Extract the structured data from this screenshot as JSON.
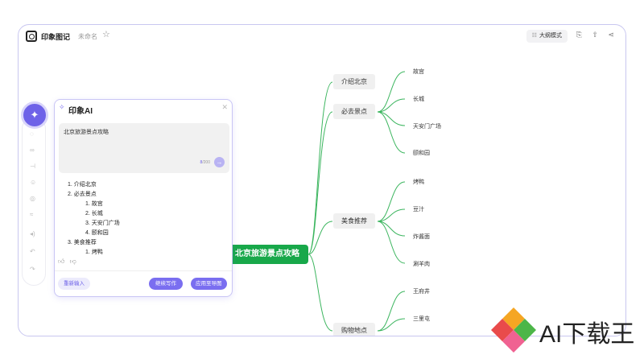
{
  "topbar": {
    "app_name": "印象图记",
    "doc_name": "未命名",
    "outline_mode": "大纲模式"
  },
  "mindmap": {
    "root": "北京旅游景点攻略",
    "branches": [
      {
        "label": "介绍北京",
        "leaves": []
      },
      {
        "label": "必去景点",
        "leaves": [
          "故宫",
          "长城",
          "天安门广场",
          "颐和园"
        ]
      },
      {
        "label": "美食推荐",
        "leaves": [
          "烤鸭",
          "豆汁",
          "炸酱面",
          "涮羊肉"
        ]
      },
      {
        "label": "购物地点",
        "leaves": [
          "王府井",
          "三里屯"
        ]
      }
    ]
  },
  "ai_panel": {
    "title": "印象AI",
    "input_text": "北京旅游景点攻略",
    "counter_current": "8",
    "counter_max": "/200",
    "result": [
      {
        "text": "1. 介绍北京",
        "level": 0
      },
      {
        "text": "2. 必去景点",
        "level": 0
      },
      {
        "text": "1. 故宫",
        "level": 1
      },
      {
        "text": "2. 长城",
        "level": 1
      },
      {
        "text": "3. 天安门广场",
        "level": 1
      },
      {
        "text": "4. 颐和园",
        "level": 1
      },
      {
        "text": "3. 美食推荐",
        "level": 0
      },
      {
        "text": "1. 烤鸭",
        "level": 1
      }
    ],
    "reset_label": "重新输入",
    "continue_label": "继续写作",
    "apply_label": "应用至导图"
  },
  "watermark": {
    "text": "AI下载王"
  },
  "colors": {
    "accent": "#6e62e8",
    "root_green": "#18a84a",
    "branch_bg": "#f0f0f0",
    "window_border": "#c9c7f0"
  },
  "icons": [
    "logo-icon",
    "star-icon",
    "outline-icon",
    "download-icon",
    "share-icon",
    "more-icon",
    "sparkle-icon",
    "close-icon",
    "send-icon",
    "thumb-up-icon",
    "thumb-down-icon"
  ]
}
